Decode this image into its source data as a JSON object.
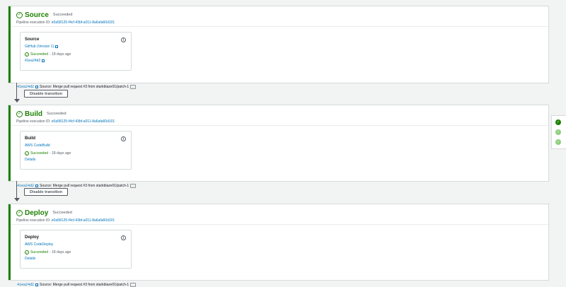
{
  "stages": [
    {
      "name": "Source",
      "status": "Succeeded",
      "execution_label": "Pipeline execution ID:",
      "execution_id": "e0a58125-f4cf-43bf-a011-8a6afa60d101",
      "action": {
        "name": "Source",
        "provider": "GitHub (Version 1)",
        "status": "Succeeded",
        "time_ago": "- 18 days ago",
        "link": "41ea24d2"
      },
      "commit_id": "41ea24d2",
      "commit_message": "Source: Merge pull request #3 from starkblaze01/patch-1",
      "more": "..."
    },
    {
      "name": "Build",
      "status": "Succeeded",
      "execution_label": "Pipeline execution ID:",
      "execution_id": "e0a58125-f4cf-43bf-a011-8a6afa60d101",
      "action": {
        "name": "Build",
        "provider": "AWS CodeBuild",
        "status": "Succeeded",
        "time_ago": "- 18 days ago",
        "link": "Details"
      },
      "commit_id": "41ea24d2",
      "commit_message": "Source: Merge pull request #3 from starkblaze01/patch-1",
      "more": "..."
    },
    {
      "name": "Deploy",
      "status": "Succeeded",
      "execution_label": "Pipeline execution ID:",
      "execution_id": "e0a58125-f4cf-43bf-a011-8a6afa60d101",
      "action": {
        "name": "Deploy",
        "provider": "AWS CodeDeploy",
        "status": "Succeeded",
        "time_ago": "- 18 days ago",
        "link": "Details"
      },
      "commit_id": "41ea24d2",
      "commit_message": "Source: Merge pull request #3 from starkblaze01/patch-1",
      "more": "..."
    }
  ],
  "transitions": [
    {
      "label": "Disable transition"
    },
    {
      "label": "Disable transition"
    }
  ],
  "icons": {
    "stage_status": "check-circle-icon",
    "info": "info-icon",
    "external_link": "external-link-icon"
  },
  "colors": {
    "success": "#1d8102",
    "link": "#0073bb",
    "background": "#f2f3f3"
  }
}
